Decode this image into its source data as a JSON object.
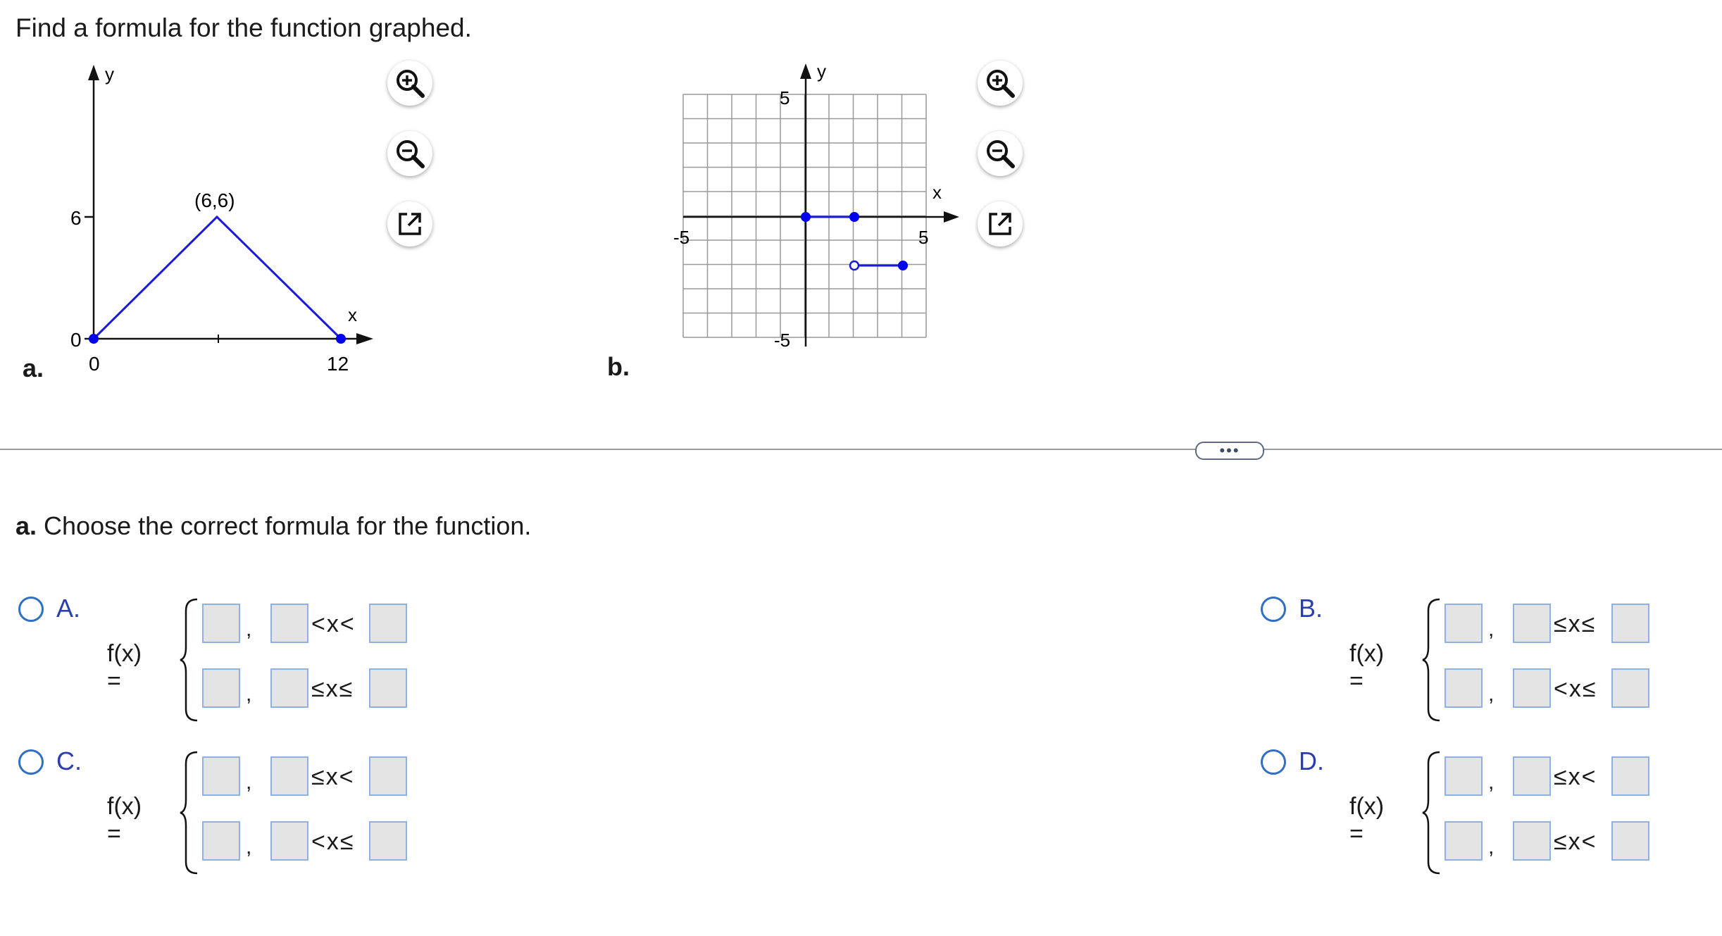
{
  "prompt": "Find a formula for the function graphed.",
  "graph_a": {
    "label": "a.",
    "y_axis_label": "y",
    "x_axis_label": "x",
    "y_tick_6": "6",
    "y_tick_0": "0",
    "x_tick_0": "0",
    "x_tick_12": "12",
    "peak_label": "(6,6)"
  },
  "graph_b": {
    "label": "b.",
    "y_axis_label": "y",
    "x_axis_label": "x",
    "tick_y_top": "5",
    "tick_y_bottom": "-5",
    "tick_x_left": "-5",
    "tick_x_right": "5"
  },
  "tools": [
    "zoom-in-icon",
    "zoom-out-icon",
    "pop-out-icon"
  ],
  "more_button": "•••",
  "question": {
    "prefix": "a.",
    "text": " Choose the correct formula for the function."
  },
  "options": [
    {
      "letter": "A.",
      "fx": "f(x) =",
      "comma": ",",
      "row1_ineq": "<x<",
      "row2_ineq": "≤x≤"
    },
    {
      "letter": "B.",
      "fx": "f(x) =",
      "comma": ",",
      "row1_ineq": "≤x≤",
      "row2_ineq": "<x≤"
    },
    {
      "letter": "C.",
      "fx": "f(x) =",
      "comma": ",",
      "row1_ineq": "≤x<",
      "row2_ineq": "<x≤"
    },
    {
      "letter": "D.",
      "fx": "f(x) =",
      "comma": ",",
      "row1_ineq": "≤x<",
      "row2_ineq": "≤x<"
    }
  ],
  "colors": {
    "accent": "#2a3eb1",
    "radio": "#2f6fc4",
    "plot_line": "#1a1adb",
    "point": "#0000ee",
    "answer_border": "#8fb0e0",
    "answer_fill": "#e4e4e4"
  }
}
